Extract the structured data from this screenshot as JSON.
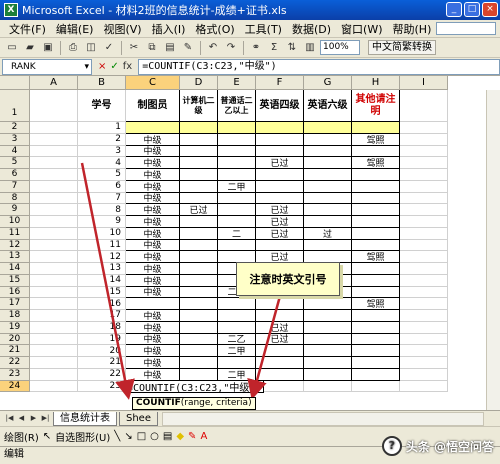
{
  "window": {
    "title": "Microsoft Excel - 材料2班的信息统计-成绩+证书.xls",
    "app_icon": "excel-icon",
    "controls": [
      "_",
      "□",
      "×"
    ]
  },
  "menu": {
    "items": [
      "文件(F)",
      "编辑(E)",
      "视图(V)",
      "插入(I)",
      "格式(O)",
      "工具(T)",
      "数据(D)",
      "窗口(W)",
      "帮助(H)"
    ],
    "doc_close": "×"
  },
  "toolbar": {
    "zoom": "100%",
    "cjk_convert": "中文简繁转换",
    "sigma": "Σ"
  },
  "formula_bar": {
    "name_box": "RANK",
    "formula": "=COUNTIF(C3:C23,\"中级\")",
    "cancel": "×",
    "enter": "✓",
    "fx": "fx"
  },
  "columns": [
    "A",
    "B",
    "C",
    "D",
    "E",
    "F",
    "G",
    "H",
    "I"
  ],
  "header_row": {
    "B": "学号",
    "C": "制图员",
    "D": "计算机二级",
    "E": "普通话二乙以上",
    "F": "英语四级",
    "G": "英语六级",
    "H": "其他请注明"
  },
  "rows": [
    {
      "n": "1"
    },
    {
      "n": "2",
      "B": "1"
    },
    {
      "n": "3",
      "B": "2",
      "C": "中级",
      "H": "驾照"
    },
    {
      "n": "4",
      "B": "3",
      "C": "中级"
    },
    {
      "n": "5",
      "B": "4",
      "C": "中级",
      "F": "已过",
      "H": "驾照"
    },
    {
      "n": "6",
      "B": "5",
      "C": "中级"
    },
    {
      "n": "7",
      "B": "6",
      "C": "中级",
      "E": "二甲"
    },
    {
      "n": "8",
      "B": "7",
      "C": "中级"
    },
    {
      "n": "9",
      "B": "8",
      "C": "中级",
      "D": "已过",
      "F": "已过"
    },
    {
      "n": "10",
      "B": "9",
      "C": "中级",
      "F": "已过"
    },
    {
      "n": "11",
      "B": "10",
      "C": "中级",
      "E": "二",
      "F": "已过",
      "G": "过"
    },
    {
      "n": "12",
      "B": "11",
      "C": "中级"
    },
    {
      "n": "13",
      "B": "12",
      "C": "中级",
      "F": "已过",
      "H": "驾照"
    },
    {
      "n": "14",
      "B": "13",
      "C": "中级",
      "F": "已过"
    },
    {
      "n": "15",
      "B": "14",
      "C": "中级",
      "F": "已过"
    },
    {
      "n": "16",
      "B": "15",
      "C": "中级",
      "E": "二乙",
      "F": "已过"
    },
    {
      "n": "17",
      "B": "16",
      "H": "驾照"
    },
    {
      "n": "18",
      "B": "17",
      "C": "中级"
    },
    {
      "n": "19",
      "B": "18",
      "C": "中级",
      "F": "已过"
    },
    {
      "n": "20",
      "B": "19",
      "C": "中级",
      "E": "二乙",
      "F": "已过"
    },
    {
      "n": "21",
      "B": "20",
      "C": "中级",
      "E": "二甲"
    },
    {
      "n": "22",
      "B": "21",
      "C": "中级"
    },
    {
      "n": "23",
      "B": "22",
      "C": "中级",
      "E": "二甲"
    },
    {
      "n": "24",
      "B": "23"
    }
  ],
  "editing_cell": "=COUNTIF(C3:C23,\"中级\")",
  "tooltip": {
    "fn": "COUNTIF",
    "args": "(range, criteria)"
  },
  "callout": "注意时英文引号",
  "sheets": {
    "active": "信息统计表",
    "next": "Shee"
  },
  "drawing": {
    "draw": "绘图(R)",
    "autoshapes": "自选图形(U)"
  },
  "status": "编辑",
  "watermark": "头条 @悟空问答",
  "colors": {
    "selected_header": "#fbd27c",
    "row2_fill": "#ffff99",
    "red_text": "#d00000",
    "arrow": "#c0242b"
  }
}
